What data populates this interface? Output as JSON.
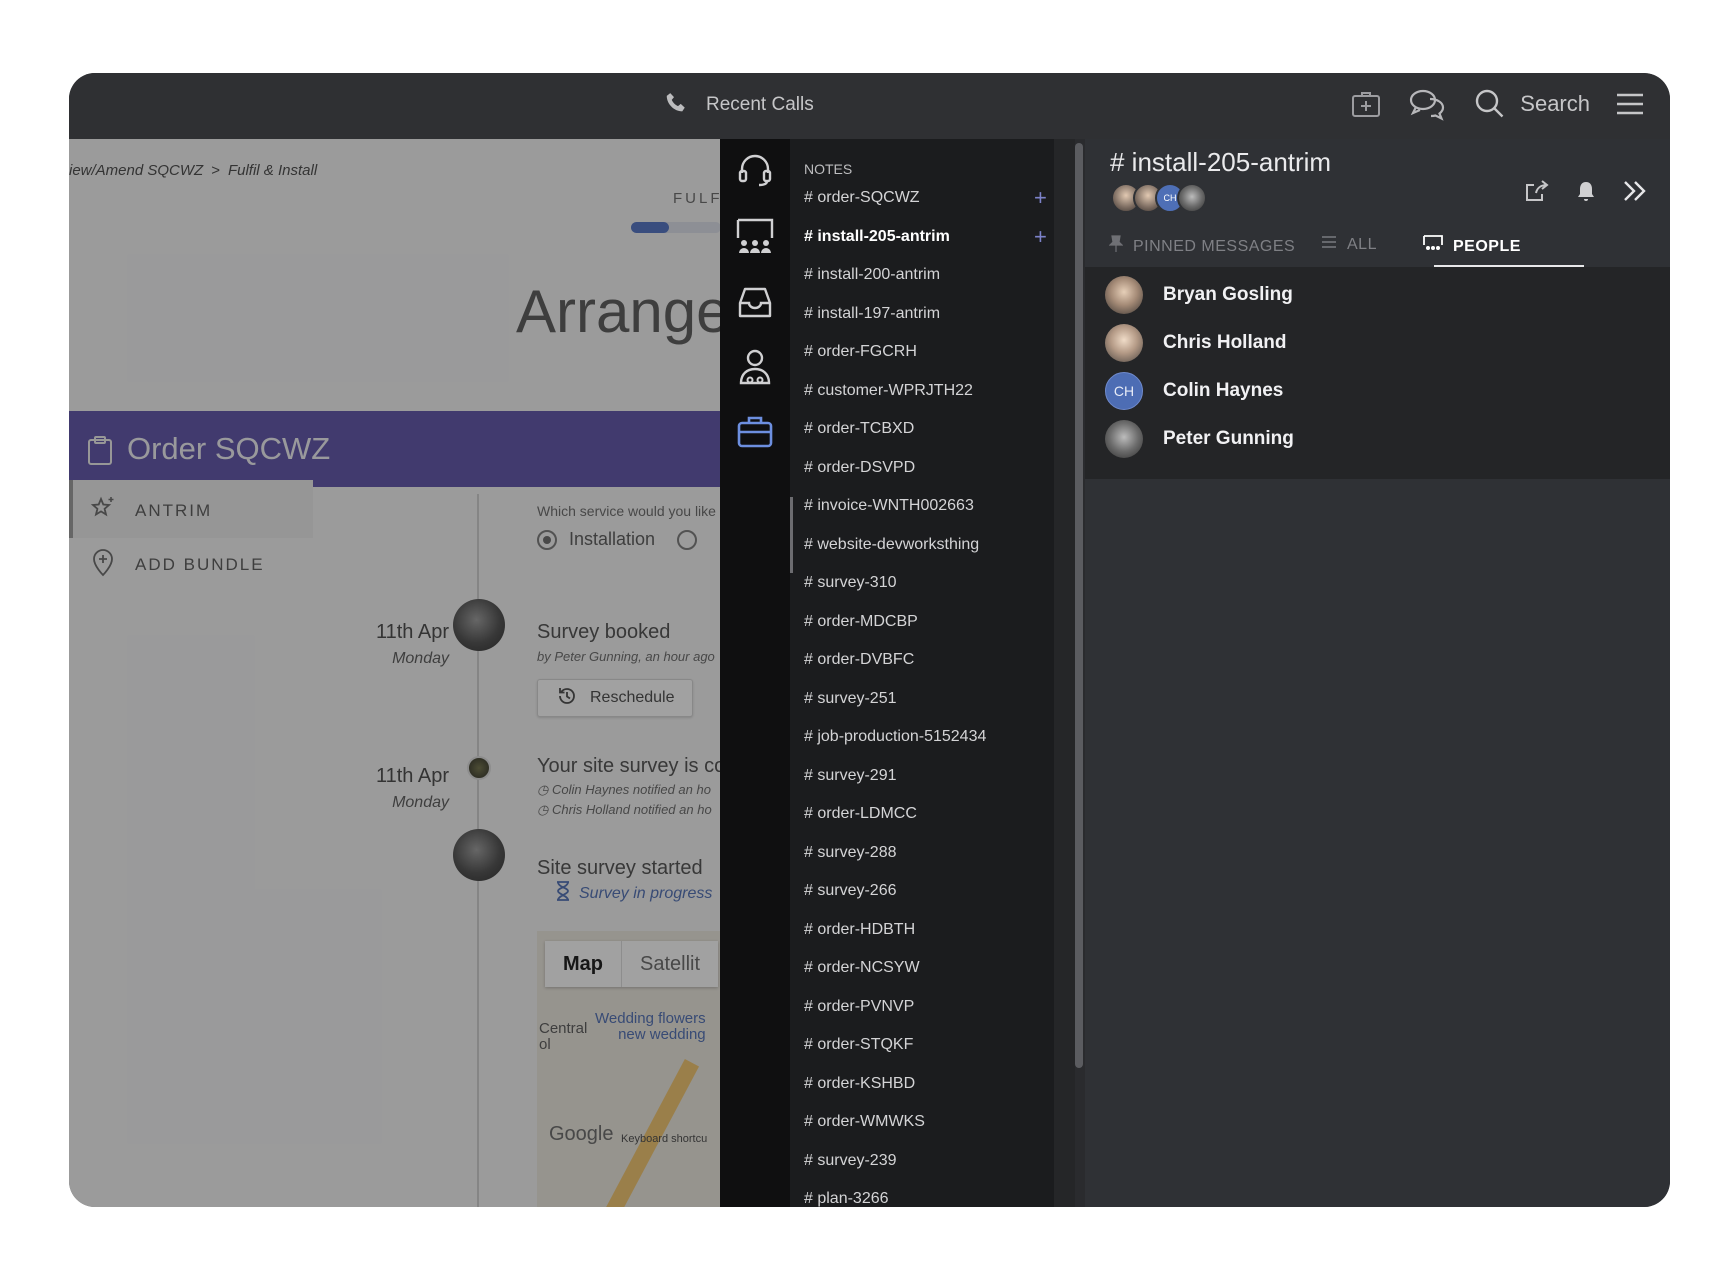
{
  "topbar": {
    "title": "Recent Calls",
    "search_label": "Search",
    "icons": [
      "phone-icon",
      "medical-case-icon",
      "chat-bubbles-icon",
      "search-icon",
      "hamburger-menu-icon"
    ]
  },
  "leftapp": {
    "breadcrumb": [
      "iew/Amend SQCWZ",
      ">",
      "Fulfil & Install"
    ],
    "step_label": "FULF",
    "progress_fraction": 0.42,
    "heading": "Arrange",
    "order_title": "Order SQCWZ",
    "sidebar": [
      {
        "label": "ANTRIM",
        "icon": "sparkle-star-icon"
      },
      {
        "label": "ADD BUNDLE",
        "icon": "map-pin-plus-icon"
      }
    ],
    "question": "Which service would you like",
    "options": [
      "Installation"
    ],
    "events": [
      {
        "date": "11th Apr",
        "day": "Monday",
        "title": "Survey booked",
        "sub": "by Peter Gunning, an hour ago"
      },
      {
        "date": "11th Apr",
        "day": "Monday",
        "title": "Your site survey is cor",
        "sub1": "Colin Haynes notified an ho",
        "sub2": "Chris Holland notified an ho"
      },
      {
        "title": "Site survey started",
        "link": "Survey in progress"
      }
    ],
    "reschedule_label": "Reschedule",
    "map": {
      "tab_map": "Map",
      "tab_sat": "Satellit",
      "text_central": "Central\nol",
      "text_wedding": "Wedding flowers\nnew wedding",
      "google": "Google",
      "keyboard": "Keyboard shortcu"
    }
  },
  "channels": {
    "header": "NOTES",
    "items": [
      {
        "name": "order-SQCWZ",
        "plus": "+"
      },
      {
        "name": "install-205-antrim",
        "plus": "+",
        "active": true
      },
      {
        "name": "install-200-antrim"
      },
      {
        "name": "install-197-antrim"
      },
      {
        "name": "order-FGCRH"
      },
      {
        "name": "customer-WPRJTH22"
      },
      {
        "name": "order-TCBXD"
      },
      {
        "name": "order-DSVPD"
      },
      {
        "name": "invoice-WNTH002663"
      },
      {
        "name": "website-devworksthing"
      },
      {
        "name": "survey-310"
      },
      {
        "name": "order-MDCBP"
      },
      {
        "name": "order-DVBFC"
      },
      {
        "name": "survey-251"
      },
      {
        "name": "job-production-5152434"
      },
      {
        "name": "survey-291"
      },
      {
        "name": "order-LDMCC"
      },
      {
        "name": "survey-288"
      },
      {
        "name": "survey-266"
      },
      {
        "name": "order-HDBTH"
      },
      {
        "name": "order-NCSYW"
      },
      {
        "name": "order-PVNVP"
      },
      {
        "name": "order-STQKF"
      },
      {
        "name": "order-KSHBD"
      },
      {
        "name": "order-WMWKS"
      },
      {
        "name": "survey-239"
      },
      {
        "name": "plan-3266"
      }
    ]
  },
  "rail": [
    "headset-icon",
    "team-board-icon",
    "inbox-tray-icon",
    "contact-person-icon",
    "briefcase-icon"
  ],
  "panel": {
    "channel_title": "# install-205-antrim",
    "mini_initials": "CH",
    "tabs": [
      "PINNED MESSAGES",
      "ALL",
      "PEOPLE"
    ],
    "people": [
      {
        "name": "Bryan Gosling"
      },
      {
        "name": "Chris Holland"
      },
      {
        "name": "Colin Haynes",
        "initials": "CH"
      },
      {
        "name": "Peter Gunning"
      }
    ]
  }
}
